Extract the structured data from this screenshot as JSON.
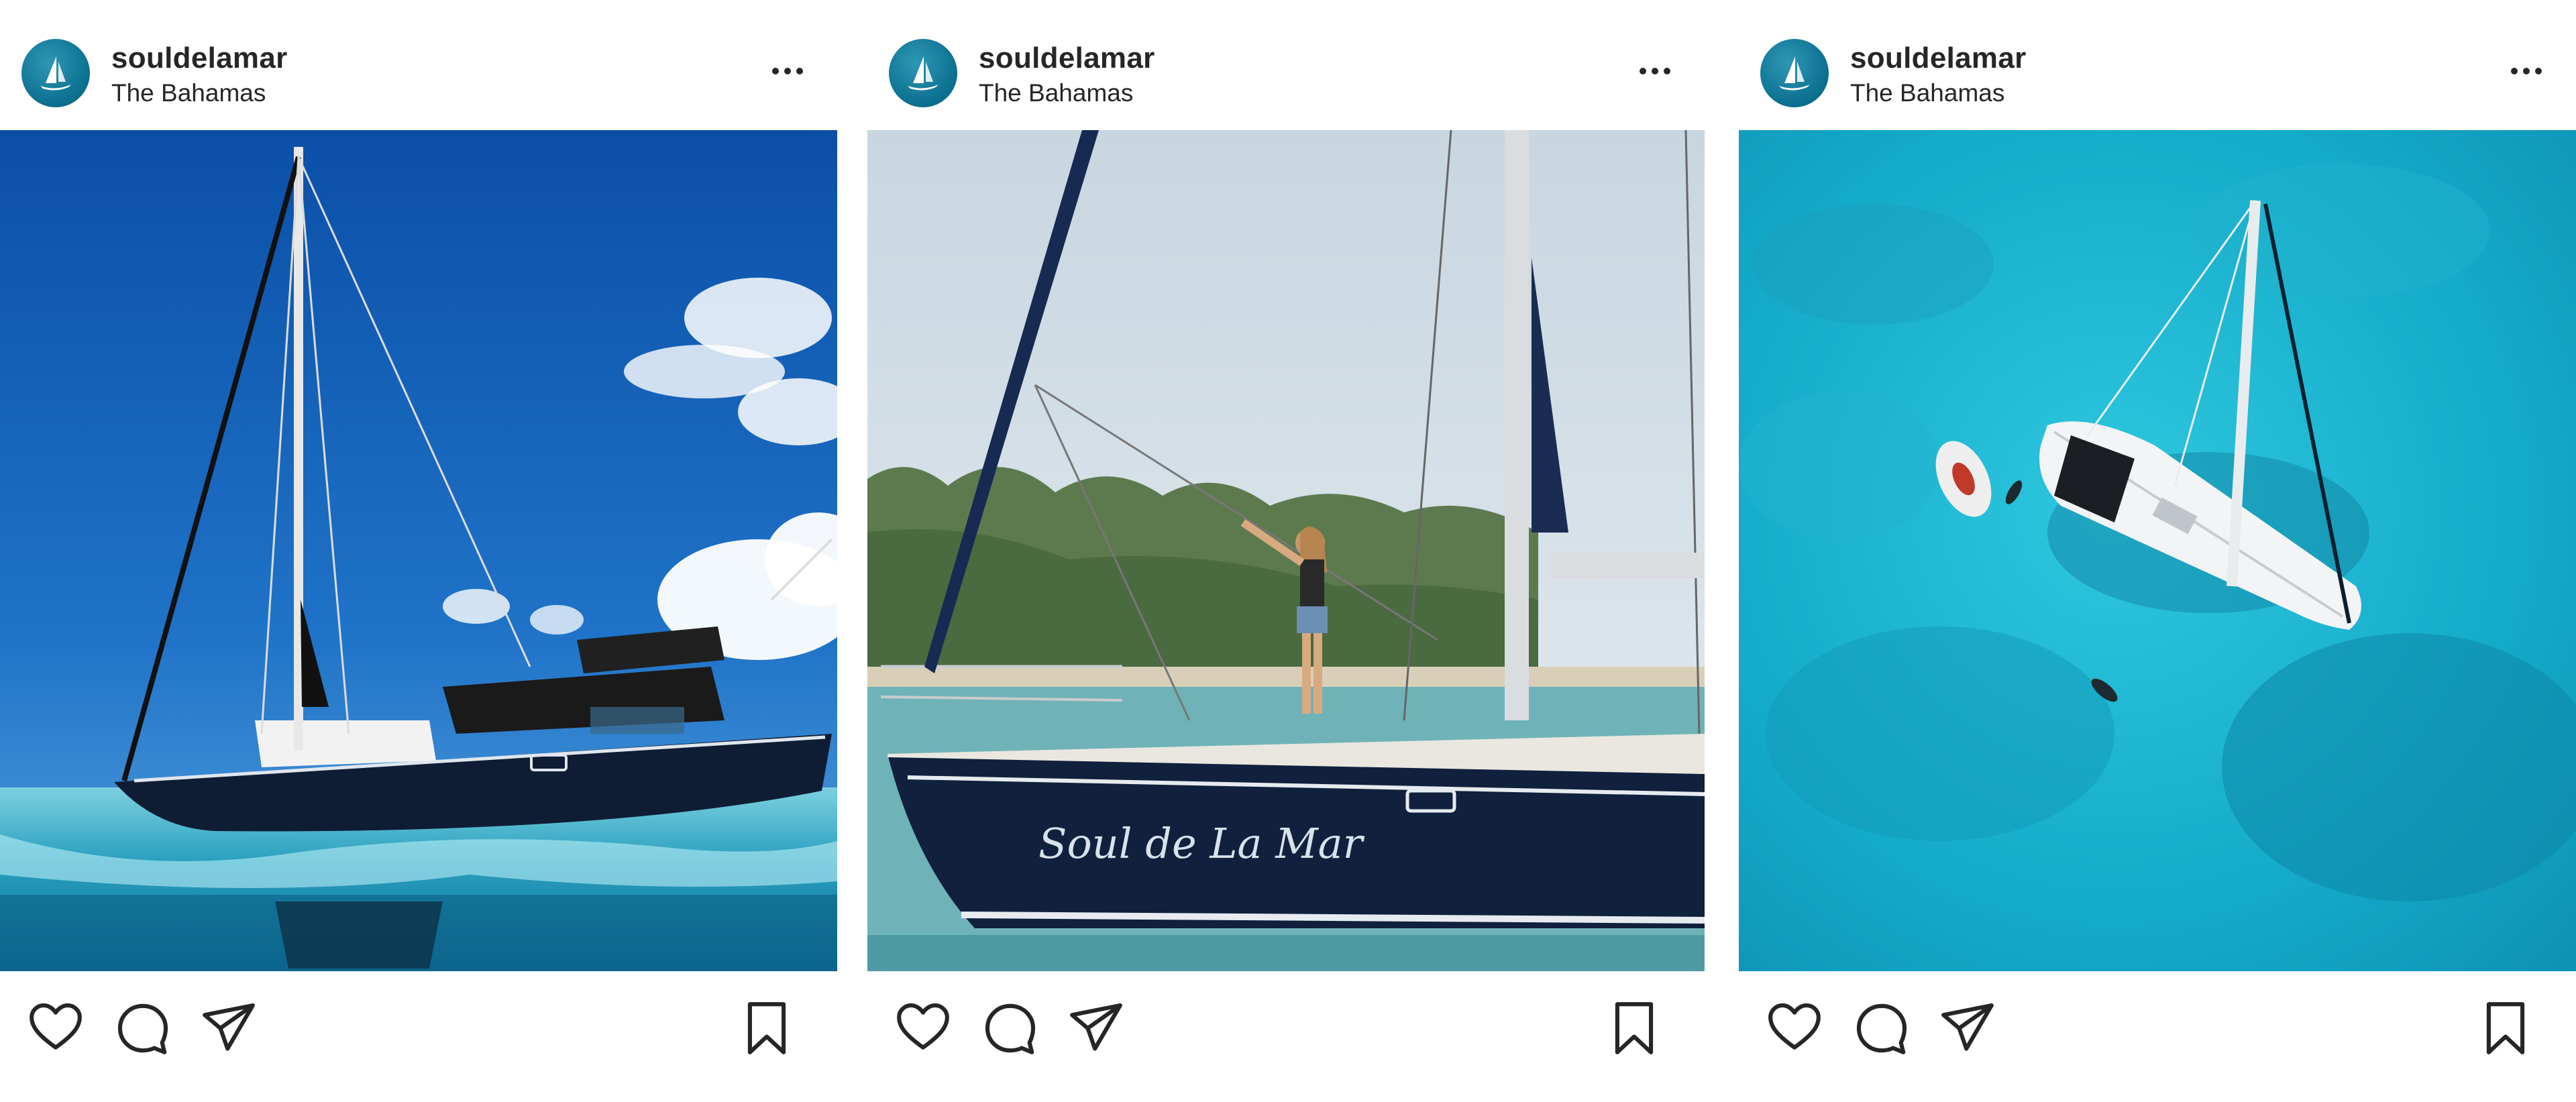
{
  "posts": [
    {
      "username": "souldelamar",
      "location": "The Bahamas",
      "photo_icon": "sailboat-underwater-split-photo",
      "actions": {
        "like": "heart-icon",
        "comment": "comment-icon",
        "share": "paper-plane-icon",
        "save": "bookmark-icon"
      }
    },
    {
      "username": "souldelamar",
      "location": "The Bahamas",
      "photo_icon": "woman-on-sailboat-bow-photo",
      "hull_text": "Soul de La Mar",
      "actions": {
        "like": "heart-icon",
        "comment": "comment-icon",
        "share": "paper-plane-icon",
        "save": "bookmark-icon"
      }
    },
    {
      "username": "souldelamar",
      "location": "The Bahamas",
      "photo_icon": "aerial-sailboat-turquoise-water-photo",
      "actions": {
        "like": "heart-icon",
        "comment": "comment-icon",
        "share": "paper-plane-icon",
        "save": "bookmark-icon"
      }
    }
  ],
  "colors": {
    "text": "#262626",
    "avatar": "#0b6f8f",
    "background": "#ffffff"
  }
}
